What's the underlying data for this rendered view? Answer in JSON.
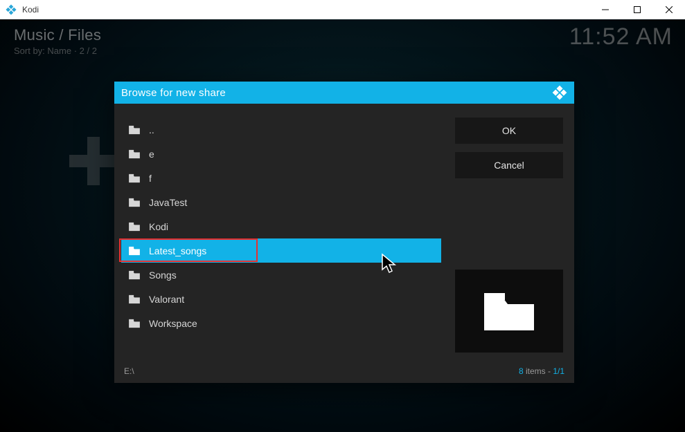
{
  "window": {
    "title": "Kodi"
  },
  "background": {
    "breadcrumb": "Music / Files",
    "sort_line": "Sort by: Name  ·  2 / 2",
    "clock": "11:52 AM"
  },
  "dialog": {
    "title": "Browse for new share",
    "ok_label": "OK",
    "cancel_label": "Cancel",
    "footer_path": "E:\\",
    "footer_count": "8",
    "footer_items_word": " items - ",
    "footer_page": "1/1",
    "items": [
      {
        "label": ".."
      },
      {
        "label": "e"
      },
      {
        "label": "f"
      },
      {
        "label": "JavaTest"
      },
      {
        "label": "Kodi"
      },
      {
        "label": "Latest_songs",
        "selected": true
      },
      {
        "label": "Songs"
      },
      {
        "label": "Valorant"
      },
      {
        "label": "Workspace"
      }
    ]
  }
}
